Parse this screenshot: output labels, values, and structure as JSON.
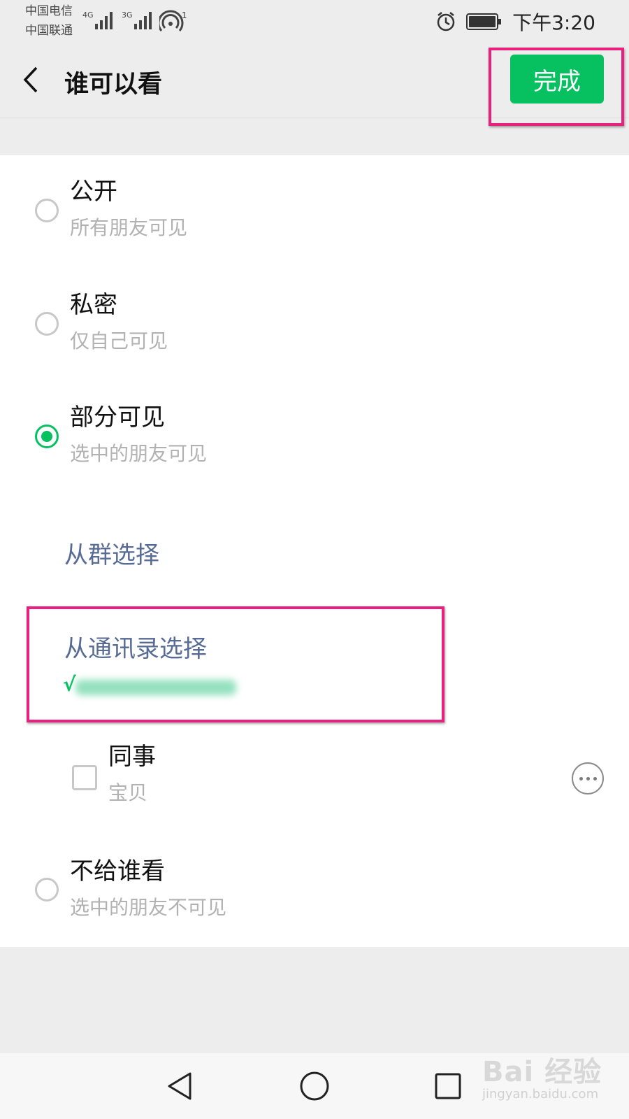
{
  "status_bar": {
    "carrier1": "中国电信",
    "carrier2": "中国联通",
    "network1": "4G",
    "network2": "3G",
    "hotspot_count": "1",
    "time": "下午3:20"
  },
  "header": {
    "title": "谁可以看",
    "done_label": "完成"
  },
  "options": [
    {
      "title": "公开",
      "subtitle": "所有朋友可见",
      "selected": false
    },
    {
      "title": "私密",
      "subtitle": "仅自己可见",
      "selected": false
    },
    {
      "title": "部分可见",
      "subtitle": "选中的朋友可见",
      "selected": true
    },
    {
      "title": "不给谁看",
      "subtitle": "选中的朋友不可见",
      "selected": false
    }
  ],
  "partial": {
    "from_group": "从群选择",
    "from_contacts": "从通讯录选择",
    "selected_prefix": "√",
    "tag_title": "同事",
    "tag_members": "宝贝"
  },
  "watermark": {
    "logo": "Bai 经验",
    "url": "jingyan.baidu.com"
  },
  "colors": {
    "accent": "#07c160",
    "link": "#576b95",
    "highlight": "#e8207e"
  }
}
